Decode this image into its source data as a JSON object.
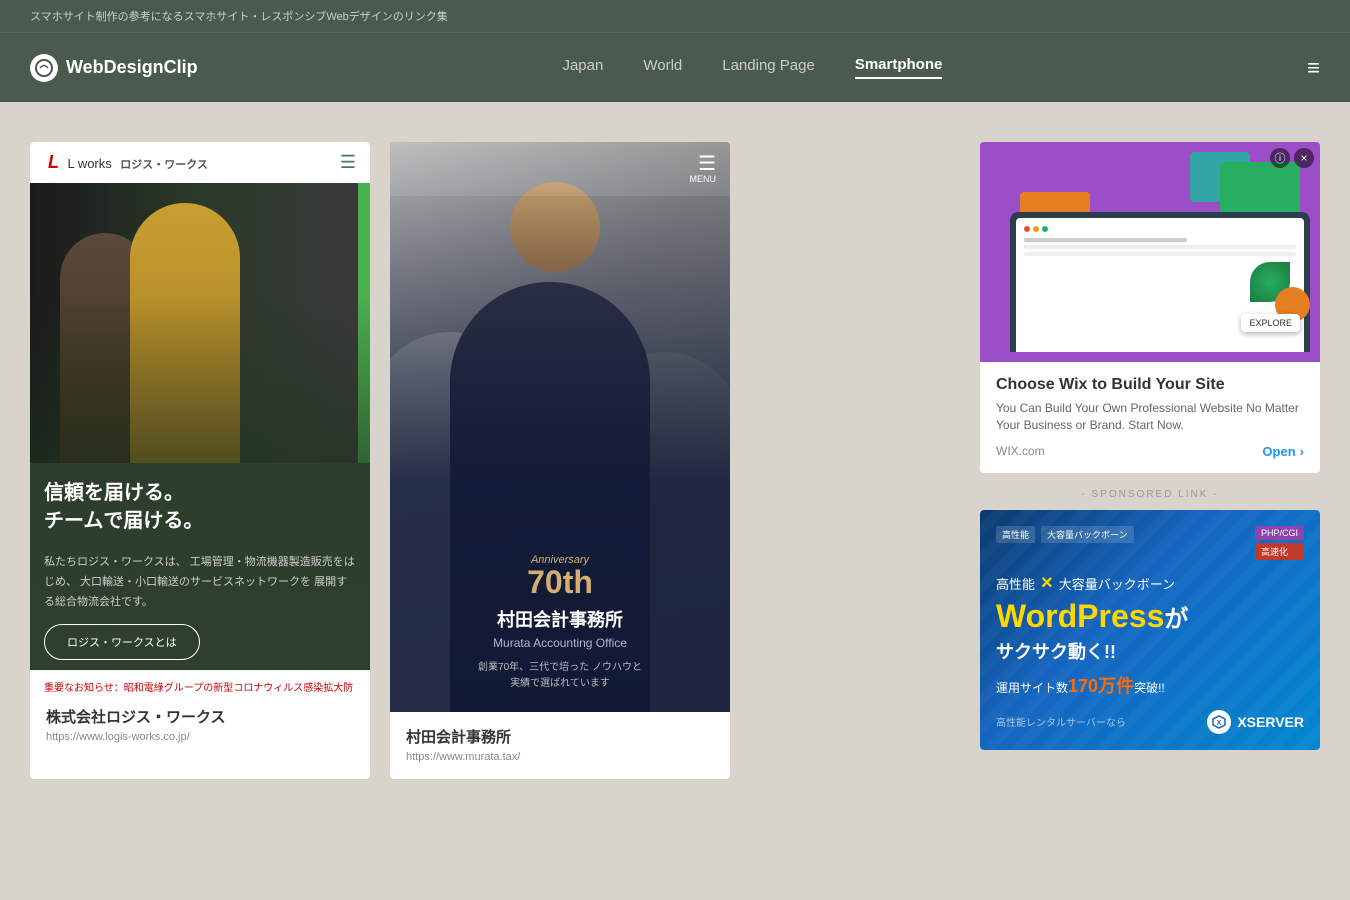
{
  "topbar": {
    "text": "スマホサイト制作の参考になるスマホサイト・レスポンシブWebデザインのリンク集"
  },
  "header": {
    "logo": "WebDesignClip",
    "logo_icon": "W",
    "nav": [
      {
        "label": "Japan",
        "active": false
      },
      {
        "label": "World",
        "active": false
      },
      {
        "label": "Landing Page",
        "active": false
      },
      {
        "label": "Smartphone",
        "active": true
      }
    ],
    "hamburger": "≡"
  },
  "cards": [
    {
      "id": "card1",
      "logo": "L works",
      "logo_sub": "ロジス・ワークス",
      "headline": "信頼を届ける。\nチームで届ける。",
      "body": "私たちロジス・ワークスは、\n工場管理・物流機器製造販売をはじめ、\n大口輸送・小口輸送のサービスネットワークを\n展開する総合物流会社です。",
      "button": "ロジス・ワークスとは",
      "notice": "重要なお知らせ：昭和電綠グループの新型コロナウィルス感染拡大防止対応について",
      "title": "株式会社ロジス・ワークス",
      "url": "https://www.logis-works.co.jp/"
    },
    {
      "id": "card2",
      "menu": "MENU",
      "anniversary": "Anniversary",
      "anniversary_num": "70th",
      "company_ja": "村田会計事務所",
      "company_en": "Murata Accounting Office",
      "desc": "創業70年、三代で培った ノウハウと\n実績で選ばれています",
      "title": "村田会計事務所",
      "url": "https://www.murata.tax/"
    }
  ],
  "sidebar": {
    "ad_wix": {
      "title": "Choose Wix to Build Your Site",
      "description": "You Can Build Your Own Professional Website No Matter Your Business or Brand. Start Now.",
      "domain": "WIX.com",
      "cta": "Open",
      "cta_arrow": "›"
    },
    "sponsored_label": "- SPONSORED LINK -",
    "ad_xserver": {
      "tag1": "高性能",
      "tag2": "大容量バックボーン",
      "tag3": "PHP/CGI",
      "tag4": "高速化",
      "line1_left": "高性能",
      "cross": "×",
      "line1_right": "大容量バックボーン",
      "wp_text": "WordPress",
      "wp_suffix": "が",
      "tagline": "サクサク動く!!",
      "count_prefix": "運用サイト数",
      "count_num": "170万件突破!!",
      "footer": "高性能レンタルサーバーなら",
      "logo": "XSERVER"
    }
  }
}
